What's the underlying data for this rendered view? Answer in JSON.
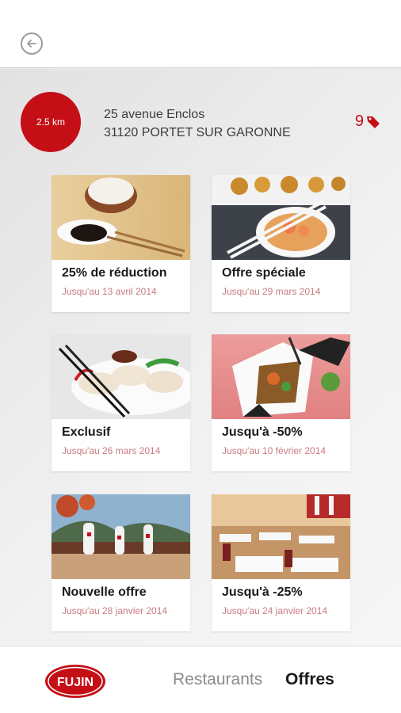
{
  "header": {
    "back_icon": "arrow-left-circle-icon"
  },
  "restaurant": {
    "distance": "2.5 km",
    "address_line1": "25 avenue Enclos",
    "address_line2": "31120 PORTET SUR GARONNE",
    "offers_count": "9",
    "offers_icon": "tag-icon",
    "accent_color": "#c50f17"
  },
  "offers": [
    {
      "title": "25% de réduction",
      "date": "Jusqu'au 13 avril 2014",
      "image": "rice-bowl-soy-sauce-photo"
    },
    {
      "title": "Offre spéciale",
      "date": "Jusqu'au 29 mars 2014",
      "image": "shrimp-soup-dumplings-photo"
    },
    {
      "title": "Exclusif",
      "date": "Jusqu'au 26 mars 2014",
      "image": "spring-rolls-chopsticks-photo"
    },
    {
      "title": "Jusqu'à -50%",
      "date": "Jusqu'au 10 février 2014",
      "image": "takeout-box-noodles-photo"
    },
    {
      "title": "Nouvelle offre",
      "date": "Jusqu'au 28 janvier 2014",
      "image": "restaurant-table-mural-photo"
    },
    {
      "title": "Jusqu'à -25%",
      "date": "Jusqu'au 24 janvier 2014",
      "image": "restaurant-dining-room-photo"
    }
  ],
  "footer": {
    "logo_text": "FUJIN",
    "tab_restaurants": "Restaurants",
    "tab_offres": "Offres"
  }
}
